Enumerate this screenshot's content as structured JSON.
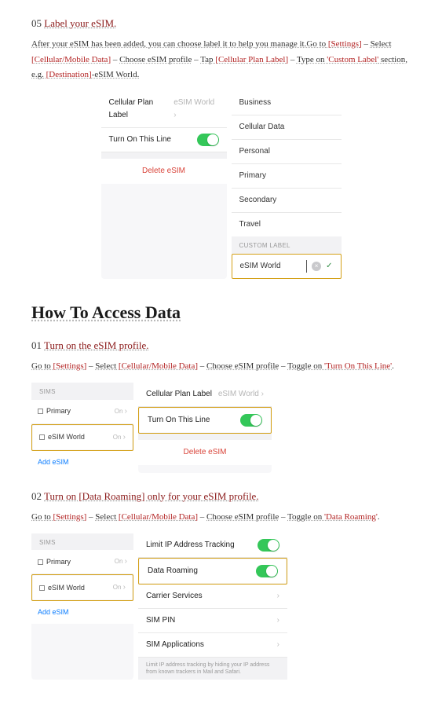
{
  "step05": {
    "num": "05",
    "title": "Label your eSIM.",
    "instr_parts": [
      {
        "t": "After your eSIM has been added, you can choose label it to help you manage it.",
        "cls": "u"
      },
      {
        "t": "Go to",
        "cls": "u"
      },
      {
        "t": " [Settings]",
        "cls": "u red"
      },
      {
        "t": " – ",
        "cls": ""
      },
      {
        "t": "Select",
        "cls": "u"
      },
      {
        "t": " [Cellular/Mobile Data]",
        "cls": "u red"
      },
      {
        "t": " – ",
        "cls": ""
      },
      {
        "t": "Choose eSIM profile",
        "cls": "u"
      },
      {
        "t": " – ",
        "cls": ""
      },
      {
        "t": "Tap",
        "cls": "u"
      },
      {
        "t": " [Cellular Plan Label]",
        "cls": "u red"
      },
      {
        "t": " – ",
        "cls": ""
      },
      {
        "t": "Type on",
        "cls": "u"
      },
      {
        "t": " 'Custom Label'",
        "cls": "u red"
      },
      {
        "t": " section, e.g.",
        "cls": "u"
      },
      {
        "t": " [Destination]",
        "cls": "u red"
      },
      {
        "t": "-eSIM World.",
        "cls": "u"
      }
    ]
  },
  "panel05": {
    "left": {
      "row1_label": "Cellular Plan Label",
      "row1_val": "eSIM World",
      "row2_label": "Turn On This Line",
      "delete": "Delete eSIM"
    },
    "right": {
      "labels": [
        "Business",
        "Cellular Data",
        "Personal",
        "Primary",
        "Secondary",
        "Travel"
      ],
      "custom_header": "CUSTOM LABEL",
      "custom_value": "eSIM World"
    }
  },
  "section_title": "How To Access Data",
  "step01": {
    "num": "01",
    "title": "Turn on the eSIM profile.",
    "instr_parts": [
      {
        "t": "Go to",
        "cls": "u"
      },
      {
        "t": " [Settings]",
        "cls": "u red"
      },
      {
        "t": " – ",
        "cls": ""
      },
      {
        "t": "Select",
        "cls": "u"
      },
      {
        "t": " [Cellular/Mobile Data]",
        "cls": "u red"
      },
      {
        "t": " – ",
        "cls": ""
      },
      {
        "t": "Choose eSIM profile",
        "cls": "u"
      },
      {
        "t": " – ",
        "cls": ""
      },
      {
        "t": "Toggle on",
        "cls": "u"
      },
      {
        "t": " 'Turn On This Line'",
        "cls": "u red"
      },
      {
        "t": ".",
        "cls": ""
      }
    ]
  },
  "panel01": {
    "sims": {
      "header": "SIMs",
      "row1": "Primary",
      "row2": "eSIM World",
      "on": "On",
      "add": "Add eSIM"
    },
    "right": {
      "row1_label": "Cellular Plan Label",
      "row1_val": "eSIM World",
      "row2_label": "Turn On This Line",
      "delete": "Delete eSIM"
    }
  },
  "step02": {
    "num": "02",
    "title": "Turn on [Data Roaming] only for your eSIM profile.",
    "instr_parts": [
      {
        "t": "Go to",
        "cls": "u"
      },
      {
        "t": " [Settings]",
        "cls": "u red"
      },
      {
        "t": " – ",
        "cls": ""
      },
      {
        "t": "Select",
        "cls": "u"
      },
      {
        "t": " [Cellular/Mobile Data]",
        "cls": "u red"
      },
      {
        "t": " – ",
        "cls": ""
      },
      {
        "t": "Choose eSIM profile",
        "cls": "u"
      },
      {
        "t": " – ",
        "cls": ""
      },
      {
        "t": "Toggle on",
        "cls": "u"
      },
      {
        "t": " 'Data Roaming'",
        "cls": "u red"
      },
      {
        "t": ".",
        "cls": ""
      }
    ]
  },
  "panel02": {
    "sims": {
      "header": "SIMs",
      "row1": "Primary",
      "row2": "eSIM World",
      "on": "On",
      "add": "Add eSIM"
    },
    "right": {
      "r1": "Limit IP Address Tracking",
      "r2": "Data Roaming",
      "r3": "Carrier Services",
      "r4": "SIM PIN",
      "r5": "SIM Applications",
      "foot": "Limit IP address tracking by hiding your IP address from known trackers in Mail and Safari."
    }
  }
}
